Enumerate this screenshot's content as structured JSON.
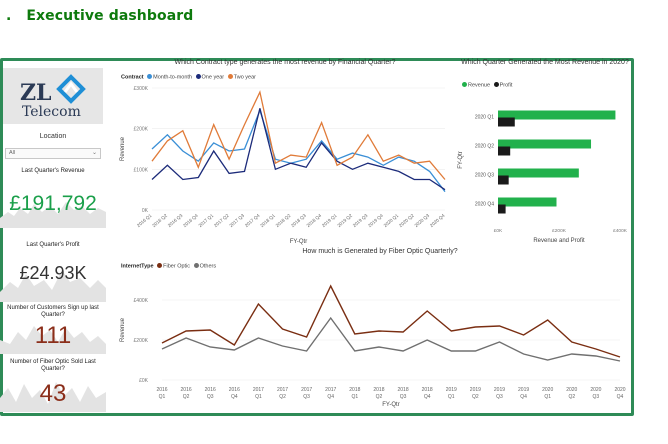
{
  "header": {
    "bullet": ".",
    "title": "Executive dashboard"
  },
  "logo": {
    "brand": "ZL",
    "sub": "Telecom"
  },
  "slicer": {
    "label": "Location",
    "value": "All"
  },
  "kpis": [
    {
      "label": "Last Quarter's Revenue",
      "value": "£191,792",
      "color": "#1a9f4a"
    },
    {
      "label": "Last Quarter's Profit",
      "value": "£24.93K",
      "color": "#333333"
    },
    {
      "label": "Number of Customers Sign up last Quarter?",
      "value": "111",
      "color": "#8b2e1a"
    },
    {
      "label": "Number of Fiber Optic Sold Last Quarter?",
      "value": "43",
      "color": "#8b2e1a"
    }
  ],
  "chart_data": [
    {
      "type": "line",
      "title": "Which Contract type generates the most revenue by Financial Quarter?",
      "legend_title": "Contract",
      "xlabel": "FY-Qtr",
      "ylabel": "Revenue",
      "ylim": [
        0,
        300000
      ],
      "yticks": [
        "0K",
        "£100K",
        "£200K",
        "£300K"
      ],
      "categories": [
        "2016 Q1",
        "2016 Q2",
        "2016 Q3",
        "2016 Q4",
        "2017 Q1",
        "2017 Q2",
        "2017 Q3",
        "2017 Q4",
        "2018 Q1",
        "2018 Q2",
        "2018 Q3",
        "2018 Q4",
        "2019 Q1",
        "2019 Q2",
        "2019 Q3",
        "2019 Q4",
        "2020 Q1",
        "2020 Q2",
        "2020 Q3",
        "2020 Q4"
      ],
      "series": [
        {
          "name": "Month-to-month",
          "color": "#3a8fd6",
          "values": [
            150000,
            185000,
            145000,
            120000,
            165000,
            145000,
            150000,
            245000,
            125000,
            115000,
            125000,
            170000,
            125000,
            140000,
            130000,
            110000,
            130000,
            120000,
            95000,
            45000
          ]
        },
        {
          "name": "One year",
          "color": "#1c2b7a",
          "values": [
            75000,
            110000,
            75000,
            80000,
            145000,
            90000,
            95000,
            250000,
            100000,
            115000,
            105000,
            165000,
            120000,
            100000,
            115000,
            105000,
            95000,
            75000,
            75000,
            50000
          ]
        },
        {
          "name": "Two year",
          "color": "#e07b39",
          "values": [
            120000,
            170000,
            195000,
            105000,
            210000,
            125000,
            210000,
            290000,
            115000,
            135000,
            130000,
            215000,
            110000,
            130000,
            185000,
            120000,
            135000,
            115000,
            120000,
            75000
          ]
        }
      ]
    },
    {
      "type": "bar",
      "orientation": "horizontal",
      "title": "Which Quarter Generated the Most Revenue in 2020?",
      "ylabel": "FY-Qtr",
      "xlabel": "Revenue and Profit",
      "xlim": [
        0,
        400000
      ],
      "xticks": [
        "£0K",
        "£200K",
        "£400K"
      ],
      "categories": [
        "2020 Q1",
        "2020 Q2",
        "2020 Q3",
        "2020 Q4"
      ],
      "series": [
        {
          "name": "Revenue",
          "color": "#22b14c",
          "values": [
            385000,
            305000,
            265000,
            191792
          ]
        },
        {
          "name": "Profit",
          "color": "#1a1a1a",
          "values": [
            55000,
            40000,
            35000,
            24930
          ]
        }
      ]
    },
    {
      "type": "line",
      "title": "How much is Generated by Fiber Optic Quarterly?",
      "legend_title": "InternetType",
      "xlabel": "FY-Qtr",
      "ylabel": "Revenue",
      "ylim": [
        0,
        500000
      ],
      "yticks": [
        "£0K",
        "£200K",
        "£400K"
      ],
      "x_years": [
        "2016",
        "2016",
        "2016",
        "2016",
        "2017",
        "2017",
        "2017",
        "2017",
        "2018",
        "2018",
        "2018",
        "2018",
        "2019",
        "2019",
        "2019",
        "2019",
        "2020",
        "2020",
        "2020",
        "2020"
      ],
      "x_quarters": [
        "Q1",
        "Q2",
        "Q3",
        "Q4",
        "Q1",
        "Q2",
        "Q3",
        "Q4",
        "Q1",
        "Q2",
        "Q3",
        "Q4",
        "Q1",
        "Q2",
        "Q3",
        "Q4",
        "Q1",
        "Q2",
        "Q3",
        "Q4"
      ],
      "series": [
        {
          "name": "Fiber Optic",
          "color": "#7a2e12",
          "values": [
            185000,
            245000,
            250000,
            175000,
            380000,
            255000,
            215000,
            470000,
            230000,
            245000,
            240000,
            345000,
            245000,
            265000,
            270000,
            225000,
            300000,
            190000,
            155000,
            115000
          ]
        },
        {
          "name": "Others",
          "color": "#707070",
          "values": [
            155000,
            210000,
            165000,
            150000,
            210000,
            170000,
            145000,
            310000,
            145000,
            165000,
            145000,
            200000,
            145000,
            145000,
            190000,
            130000,
            100000,
            130000,
            120000,
            95000
          ]
        }
      ]
    }
  ]
}
